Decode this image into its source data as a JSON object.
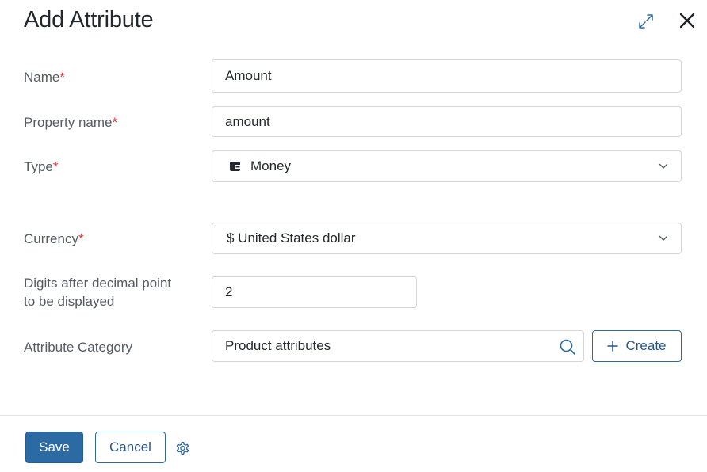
{
  "dialog": {
    "title": "Add Attribute"
  },
  "form": {
    "name": {
      "label": "Name",
      "required_mark": "*",
      "value": "Amount"
    },
    "property_name": {
      "label": "Property name",
      "required_mark": "*",
      "value": "amount"
    },
    "type": {
      "label": "Type",
      "required_mark": "*",
      "value": "Money",
      "icon": "wallet-icon"
    },
    "currency": {
      "label": "Currency",
      "required_mark": "*",
      "value": "$ United States dollar"
    },
    "digits": {
      "label_line1": "Digits after decimal point",
      "label_line2": "to be displayed",
      "value": "2"
    },
    "category": {
      "label": "Attribute Category",
      "value": "Product attributes",
      "create_label": "Create"
    }
  },
  "footer": {
    "save_label": "Save",
    "cancel_label": "Cancel"
  },
  "colors": {
    "accent": "#2c6aa4",
    "required": "#d62f2f"
  }
}
